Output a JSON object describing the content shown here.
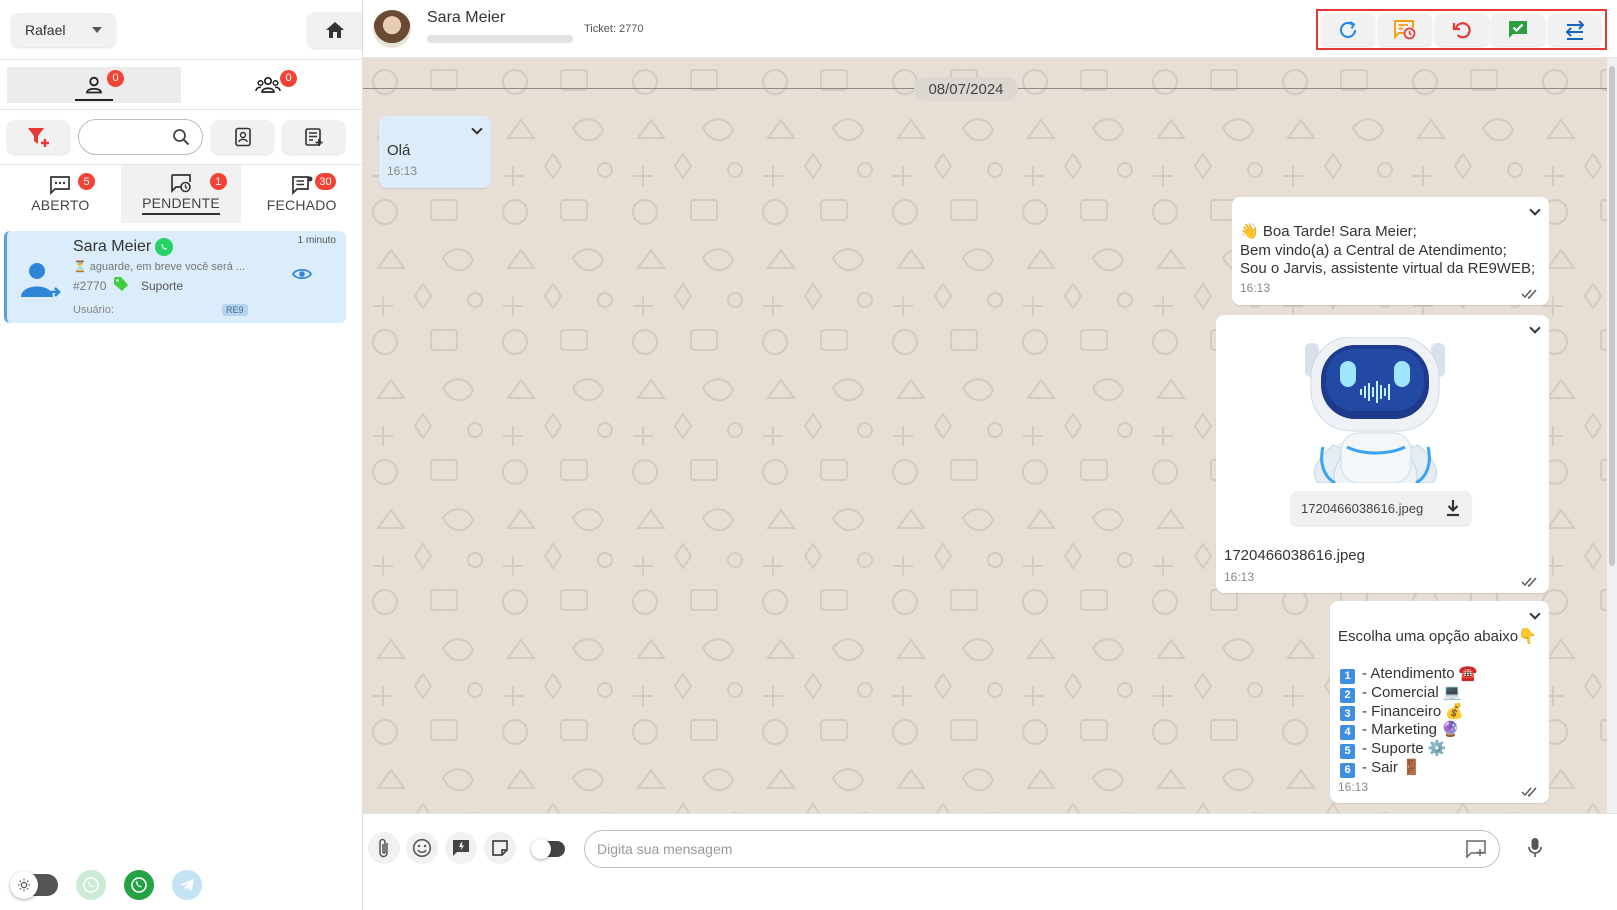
{
  "sidebar": {
    "user_name": "Rafael",
    "tab_counts": {
      "mine": "0",
      "group": "0"
    },
    "status_tabs": [
      {
        "label": "ABERTO",
        "count": "5"
      },
      {
        "label": "PENDENTE",
        "count": "1"
      },
      {
        "label": "FECHADO",
        "count": "30"
      }
    ],
    "search": {
      "value": ""
    },
    "ticket": {
      "name": "Sara Meier",
      "time": "1 minuto",
      "preview": "⏳ aguarde, em breve você será ...",
      "number": "#2770",
      "queue": "Suporte",
      "user_label": "Usuário:",
      "company_tag": "RE9"
    }
  },
  "chat": {
    "header": {
      "contact_name": "Sara Meier",
      "ticket": "Ticket: 2770"
    },
    "date": "08/07/2024",
    "messages": {
      "m1": {
        "text": "Olá",
        "time": "16:13"
      },
      "m2": {
        "l1_pre": "👋 Boa Tarde! ",
        "l1_bold": "Sara Meier",
        "l1_post": ";",
        "l2": "Bem vindo(a) a Central de Atendimento;",
        "l3_pre": "Sou o Jarvis, assistente virtual da ",
        "l3_bold": "RE9WEB",
        "l3_post": ";",
        "time": "16:13"
      },
      "m3": {
        "file_name": "1720466038616.jpeg",
        "caption": "1720466038616.jpeg",
        "time": "16:13"
      },
      "m4": {
        "title": "Escolha uma opção abaixo👇",
        "options": [
          {
            "num": "1",
            "text": "- Atendimento ☎️"
          },
          {
            "num": "2",
            "text": "- Comercial 💻"
          },
          {
            "num": "3",
            "text": "- Financeiro 💰"
          },
          {
            "num": "4",
            "text": "- Marketing 🔮"
          },
          {
            "num": "5",
            "text": "- Suporte ⚙️"
          },
          {
            "num": "6",
            "text": "- Sair 🚪"
          }
        ],
        "time": "16:13"
      }
    },
    "input": {
      "placeholder": "Digita sua mensagem"
    }
  },
  "colors": {
    "accent_blue": "#3f8fe0",
    "badge_red": "#f44336",
    "whatsapp_green": "#25d366",
    "action_highlight": "#e53935",
    "chat_background": "#e7ded6"
  }
}
